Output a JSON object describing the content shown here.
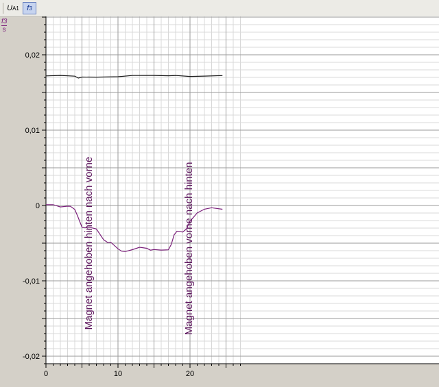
{
  "toolbar": {
    "ua1_label": "U",
    "ua1_sub": "A1",
    "f3_label": "f",
    "f3_sub": "3"
  },
  "unit_label": {
    "numerator": "f3",
    "denominator": "s"
  },
  "colors": {
    "series_black": "#1a1a1a",
    "series_purple": "#7a1f7a",
    "annotation": "#5c145c",
    "grid_major": "#9a9a9a",
    "grid_minor": "#d8d8d8",
    "plot_bg": "#ffffff"
  },
  "chart_data": {
    "type": "line",
    "xlim": [
      0,
      27.5
    ],
    "ylim": [
      -0.021,
      0.025
    ],
    "x_ticks": [
      0,
      10,
      20
    ],
    "x_tick_labels": [
      "0",
      "10",
      "20"
    ],
    "y_ticks": [
      0.02,
      0.01,
      0,
      -0.01,
      -0.02
    ],
    "y_tick_labels": [
      "0,02",
      "0,01",
      "0",
      "-0,01",
      "-0,02"
    ],
    "grid": true,
    "series": [
      {
        "color": "#1a1a1a",
        "x": [
          0,
          2,
          4,
          4.5,
          5,
          7,
          10,
          12,
          15,
          17,
          18,
          20,
          22,
          24.5
        ],
        "y": [
          0.0172,
          0.0172,
          0.0171,
          0.0169,
          0.0171,
          0.0171,
          0.0171,
          0.0172,
          0.0172,
          0.0172,
          0.0173,
          0.0172,
          0.0172,
          0.0172
        ]
      },
      {
        "color": "#7a1f7a",
        "x": [
          0,
          1,
          2,
          3,
          3.4,
          4,
          4.4,
          5,
          5.4,
          6,
          7,
          8,
          8.6,
          9,
          10,
          10.5,
          11,
          12,
          13,
          14,
          14.5,
          15,
          16,
          17,
          17.4,
          17.8,
          18.2,
          19,
          19.5,
          20,
          21,
          22,
          23,
          24.5
        ],
        "y": [
          0.0,
          0.0,
          -0.0002,
          0.0,
          0.0,
          -0.0005,
          -0.0015,
          -0.003,
          -0.003,
          -0.0028,
          -0.003,
          -0.0045,
          -0.005,
          -0.005,
          -0.0058,
          -0.006,
          -0.006,
          -0.0058,
          -0.0056,
          -0.0058,
          -0.006,
          -0.0058,
          -0.0058,
          -0.0058,
          -0.0052,
          -0.004,
          -0.0035,
          -0.0035,
          -0.003,
          -0.002,
          -0.001,
          -0.0006,
          -0.0004,
          -0.0005
        ]
      }
    ],
    "annotations": [
      {
        "text": "Magnet angehoben hinten nach vorne",
        "x": 6.4,
        "y": -0.0165
      },
      {
        "text": "Magnet angehoben vorne nach hinten",
        "x": 20.3,
        "y": -0.0172
      }
    ]
  }
}
